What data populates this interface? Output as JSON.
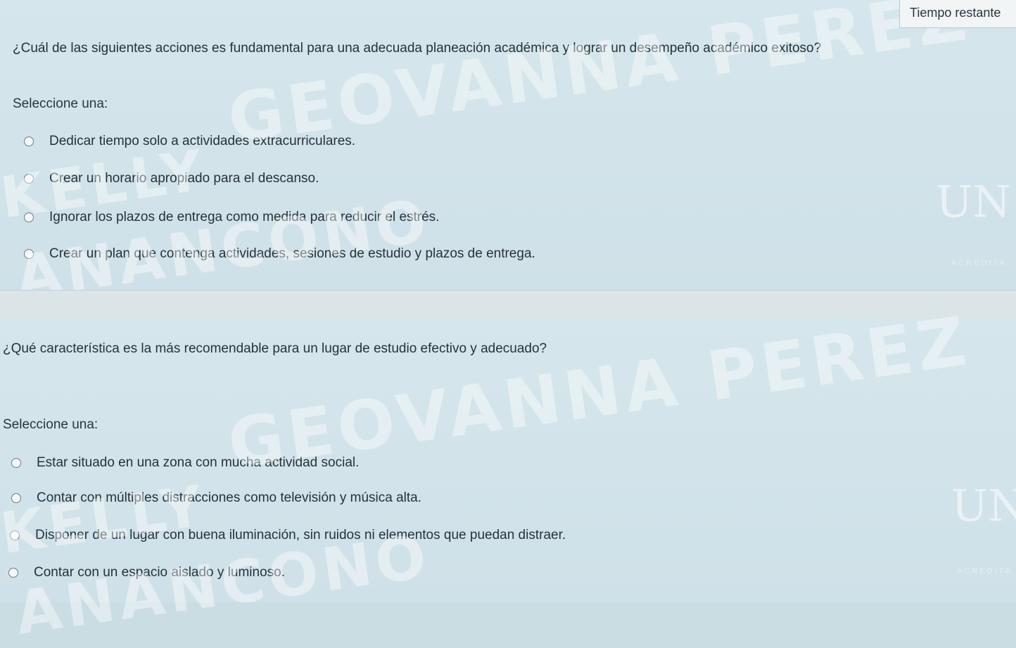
{
  "timer": {
    "label": "Tiempo restante"
  },
  "questions": [
    {
      "text": "¿Cuál de las siguientes acciones es fundamental para una adecuada planeación académica y lograr un desempeño académico exitoso?",
      "prompt": "Seleccione una:",
      "options": [
        "Dedicar tiempo solo a actividades extracurriculares.",
        "Crear un horario apropiado para el descanso.",
        "Ignorar los plazos de entrega como medida para reducir el estrés.",
        "Crear un plan que contenga actividades, sesiones de estudio y plazos de entrega."
      ]
    },
    {
      "text": "¿Qué característica es la más recomendable para un lugar de estudio efectivo y adecuado?",
      "prompt": "Seleccione una:",
      "options": [
        "Estar situado en una zona con mucha actividad social.",
        "Contar con múltiples distracciones como televisión y música alta.",
        "Disponer de un lugar con buena iluminación, sin ruidos ni elementos que puedan distraer.",
        "Contar con un espacio aislado y luminoso."
      ]
    }
  ],
  "watermarks": [
    "GEOVANNA PEREZ",
    "KELLY",
    "ANANCONO"
  ],
  "logo": {
    "text": "UN",
    "sub": "ACREDITA"
  },
  "colors": {
    "background": "#cfe1e8",
    "text": "#26323a",
    "radio_border": "#6f7a80"
  }
}
